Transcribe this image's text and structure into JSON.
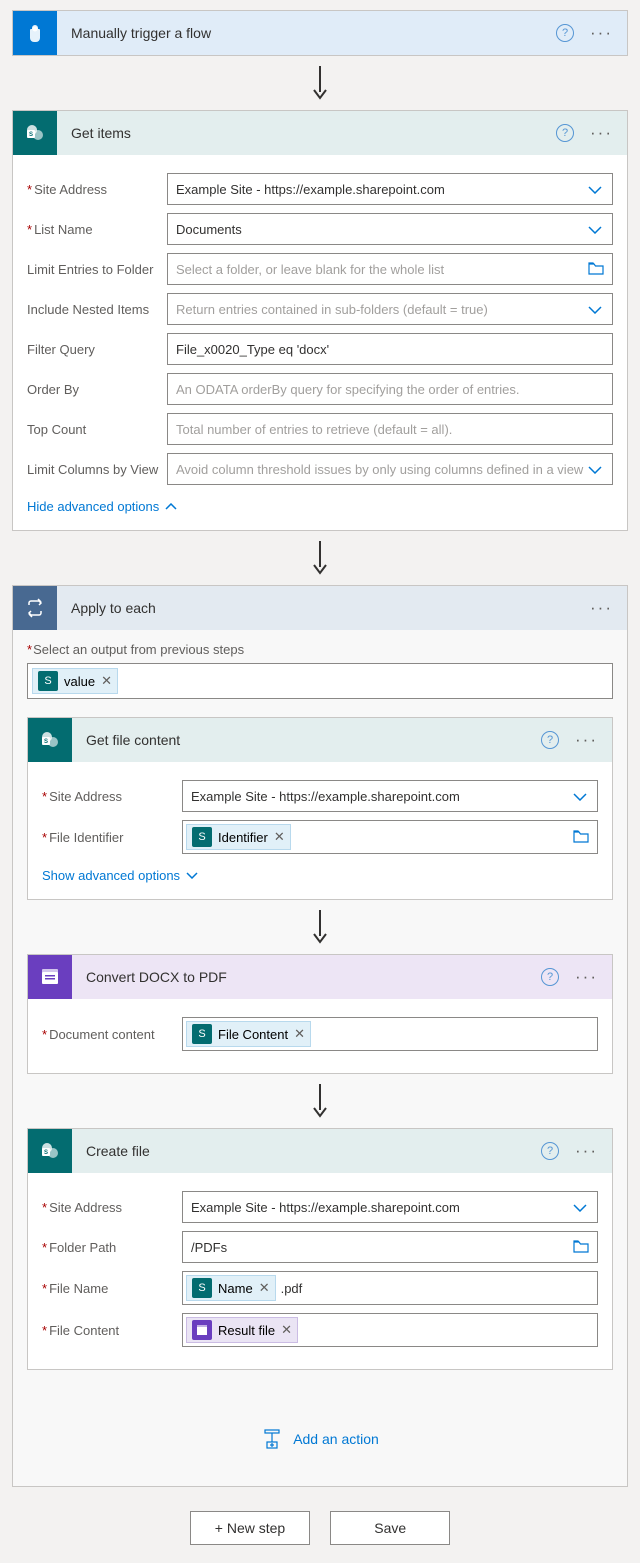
{
  "trigger": {
    "title": "Manually trigger a flow"
  },
  "getItems": {
    "title": "Get items",
    "siteAddressLabel": "Site Address",
    "siteAddressValue": "Example Site - https://example.sharepoint.com",
    "listNameLabel": "List Name",
    "listNameValue": "Documents",
    "limitFolderLabel": "Limit Entries to Folder",
    "limitFolderPlaceholder": "Select a folder, or leave blank for the whole list",
    "nestedLabel": "Include Nested Items",
    "nestedPlaceholder": "Return entries contained in sub-folders (default = true)",
    "filterLabel": "Filter Query",
    "filterValue": "File_x0020_Type eq 'docx'",
    "orderByLabel": "Order By",
    "orderByPlaceholder": "An ODATA orderBy query for specifying the order of entries.",
    "topCountLabel": "Top Count",
    "topCountPlaceholder": "Total number of entries to retrieve (default = all).",
    "limitColsLabel": "Limit Columns by View",
    "limitColsPlaceholder": "Avoid column threshold issues by only using columns defined in a view",
    "hideAdvanced": "Hide advanced options"
  },
  "applyEach": {
    "title": "Apply to each",
    "selectOutputLabel": "Select an output from previous steps",
    "valueToken": "value"
  },
  "getFileContent": {
    "title": "Get file content",
    "siteAddressLabel": "Site Address",
    "siteAddressValue": "Example Site - https://example.sharepoint.com",
    "fileIdLabel": "File Identifier",
    "identifierToken": "Identifier",
    "showAdvanced": "Show advanced options"
  },
  "convert": {
    "title": "Convert DOCX to PDF",
    "docContentLabel": "Document content",
    "fileContentToken": "File Content"
  },
  "createFile": {
    "title": "Create file",
    "siteAddressLabel": "Site Address",
    "siteAddressValue": "Example Site - https://example.sharepoint.com",
    "folderPathLabel": "Folder Path",
    "folderPathValue": "/PDFs",
    "fileNameLabel": "File Name",
    "nameToken": "Name",
    "pdfSuffix": ".pdf",
    "fileContentLabel": "File Content",
    "resultFileToken": "Result file"
  },
  "addAction": "Add an action",
  "newStep": "+ New step",
  "save": "Save"
}
